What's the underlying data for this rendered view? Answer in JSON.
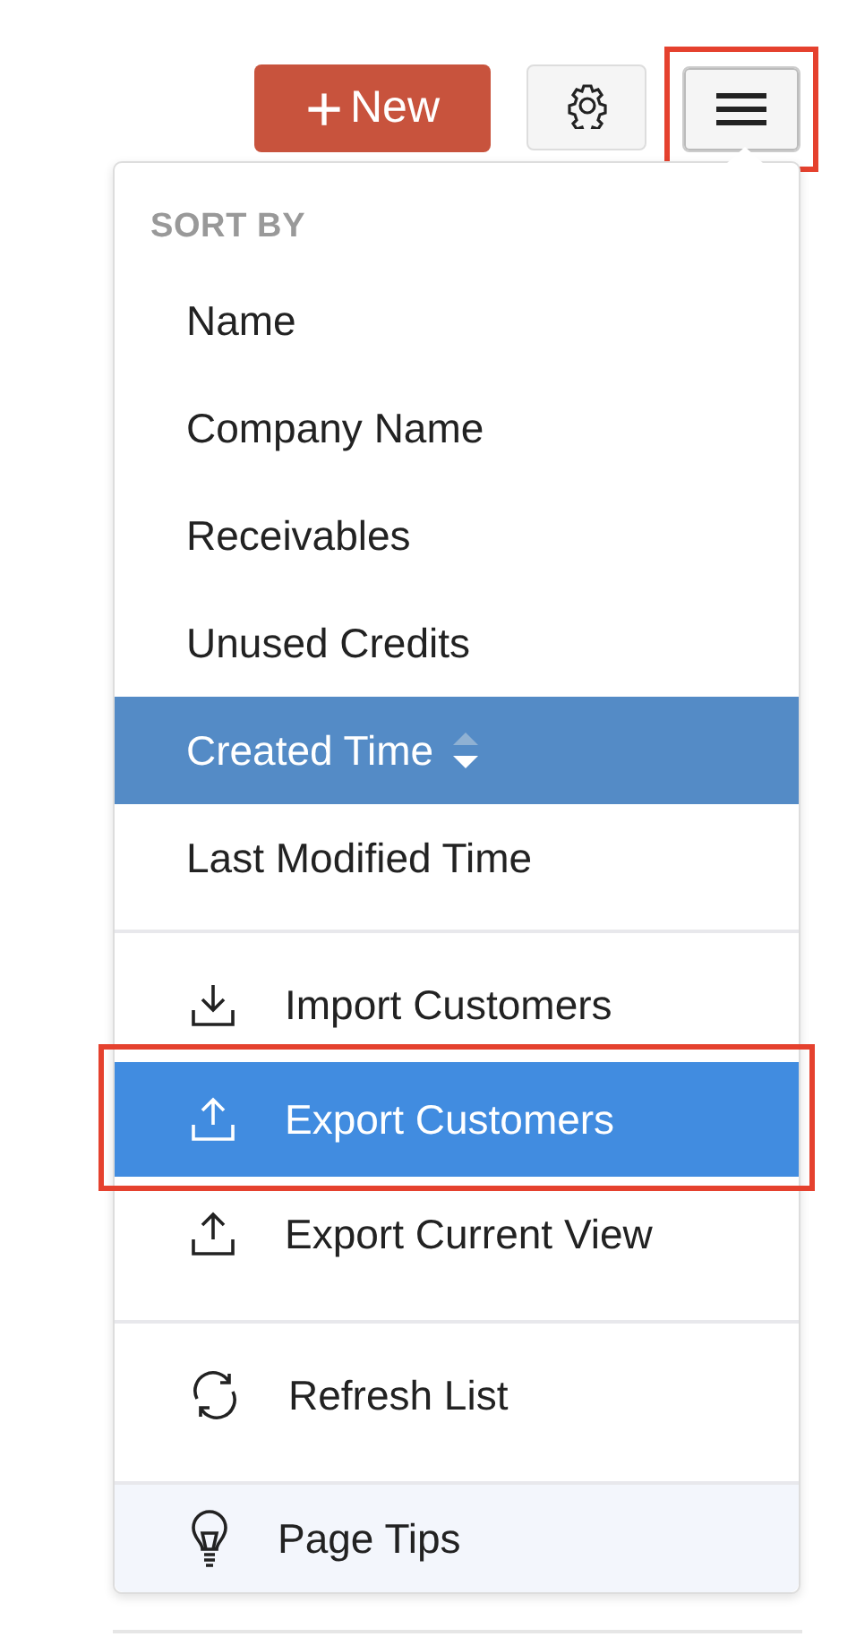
{
  "toolbar": {
    "new_button": {
      "icon": "+",
      "label": "New"
    },
    "menu_button": {
      "pressed": true
    }
  },
  "menu": {
    "heading": "SORT BY",
    "sort_options": [
      {
        "label": "Name",
        "selected": false
      },
      {
        "label": "Company Name",
        "selected": false
      },
      {
        "label": "Receivables",
        "selected": false
      },
      {
        "label": "Unused Credits",
        "selected": false
      },
      {
        "label": "Created Time",
        "selected": true
      },
      {
        "label": "Last Modified Time",
        "selected": false
      }
    ],
    "action_groups": [
      [
        {
          "label": "Import Customers",
          "kind": "import",
          "highlighted": false
        },
        {
          "label": "Export Customers",
          "kind": "export",
          "highlighted": true
        },
        {
          "label": "Export Current View",
          "kind": "export",
          "highlighted": false
        }
      ],
      [
        {
          "label": "Refresh List",
          "kind": "refresh",
          "highlighted": false
        }
      ],
      [
        {
          "label": "Page Tips",
          "kind": "tips",
          "highlighted": false
        }
      ]
    ]
  }
}
